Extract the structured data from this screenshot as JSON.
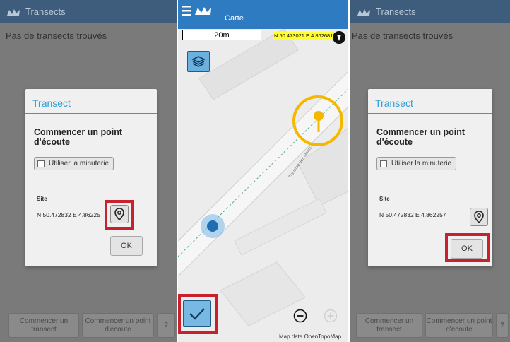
{
  "left": {
    "appbar_title": "Transects",
    "empty_message": "Pas de transects trouvés",
    "dialog": {
      "title": "Transect",
      "heading": "Commencer un point d'écoute",
      "timer_label": "Utiliser la minuterie",
      "site_label": "Site",
      "coords": "N 50.472832 E 4.86225",
      "ok_label": "OK"
    },
    "buttons": {
      "start_transect": "Commencer un transect",
      "start_point": "Commencer un point d'écoute",
      "help": "?"
    }
  },
  "map": {
    "title": "Carte",
    "scale_label": "20m",
    "coords_chip": "N 50.473021 E 4.862681",
    "road_label": "Traverse des Monts",
    "attribution": "Map data OpenTopoMap"
  },
  "right": {
    "appbar_title": "Transects",
    "empty_message": "Pas de transects trouvés",
    "dialog": {
      "title": "Transect",
      "heading": "Commencer un point d'écoute",
      "timer_label": "Utiliser la minuterie",
      "site_label": "Site",
      "coords": "N 50.472832 E 4.862257",
      "ok_label": "OK"
    },
    "buttons": {
      "start_transect": "Commencer un transect",
      "start_point": "Commencer un point d'écoute",
      "help": "?"
    }
  },
  "colors": {
    "appbar": "#3e5d7c",
    "map_bar": "#2e7bc2",
    "accent": "#2e9ed6",
    "highlight": "#c8202c",
    "marker": "#f5b800",
    "location_dot": "#1f6db3"
  },
  "icons": [
    "cloud-logo-icon",
    "menu-icon",
    "layers-icon",
    "map-pin-icon",
    "check-icon",
    "zoom-out-icon",
    "zoom-in-icon",
    "compass-icon"
  ]
}
